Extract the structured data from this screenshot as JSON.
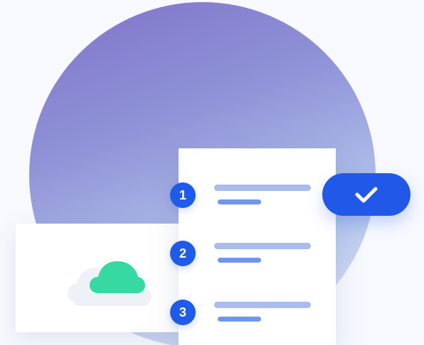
{
  "illustration": {
    "steps": [
      {
        "number": "1"
      },
      {
        "number": "2"
      },
      {
        "number": "3"
      }
    ],
    "status_icon": "checkmark-icon",
    "cloud_icon": "cloud-icon",
    "colors": {
      "circle_start": "#7f73c9",
      "circle_end": "#e6edf9",
      "card_bg": "#ffffff",
      "step_badge": "#1f5be8",
      "line_main": "#a8bced",
      "line_sub": "#6f95ef",
      "cloud_green": "#35d9a1",
      "cloud_shadow": "#eef2f8",
      "button_bg": "#2158e8"
    }
  }
}
